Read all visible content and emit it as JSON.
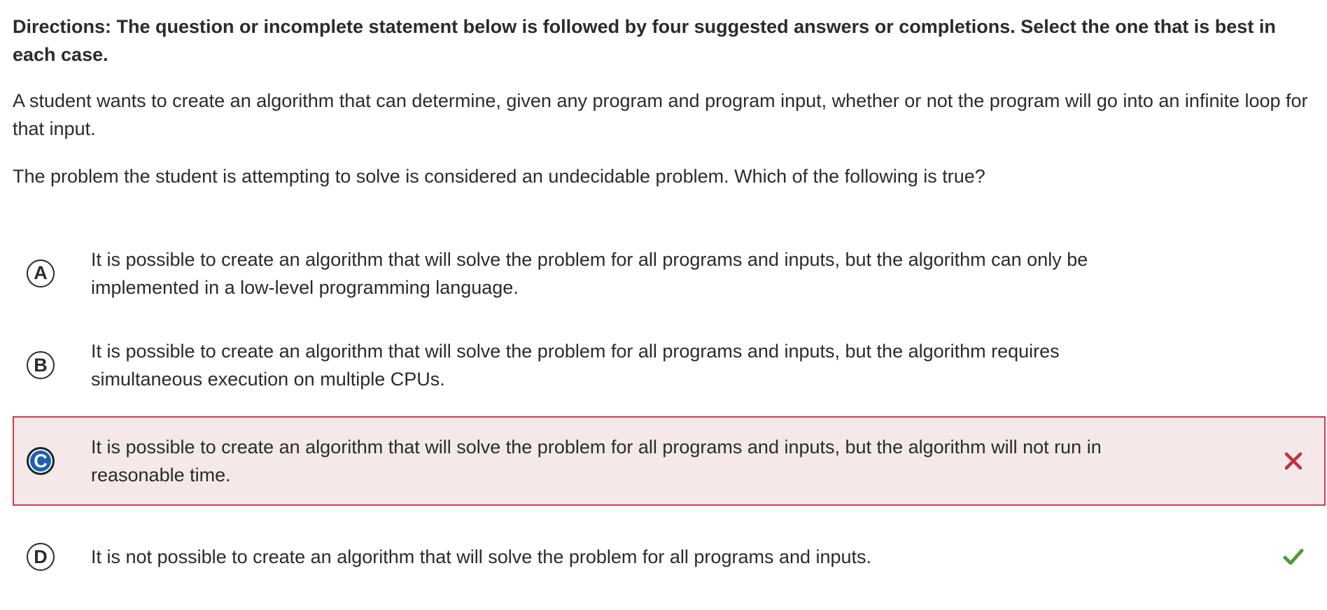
{
  "question": {
    "directions": "Directions: The question or incomplete statement below is followed by four suggested answers or completions. Select the one that is best in each case.",
    "stem_paragraphs": [
      "A student wants to create an algorithm that can determine, given any program and program input, whether or not the program will go into an infinite loop for that input.",
      "The problem the student is attempting to solve is considered an undecidable problem. Which of the following is true?"
    ]
  },
  "choices": [
    {
      "letter": "A",
      "text": "It is possible to create an algorithm that will solve the problem for all programs and inputs, but the algorithm can only be implemented in a low-level programming language.",
      "state": "none"
    },
    {
      "letter": "B",
      "text": "It is possible to create an algorithm that will solve the problem for all programs and inputs, but the algorithm requires simultaneous execution on multiple CPUs.",
      "state": "none"
    },
    {
      "letter": "C",
      "text": "It is possible to create an algorithm that will solve the problem for all programs and inputs, but the algorithm will not run in reasonable time.",
      "state": "selected-incorrect",
      "status_icon": "close-x-icon"
    },
    {
      "letter": "D",
      "text": "It is not possible to create an algorithm that will solve the problem for all programs and inputs.",
      "state": "correct",
      "status_icon": "checkmark-icon"
    }
  ],
  "colors": {
    "selected_fill": "#1f5fb0",
    "incorrect_border": "#d13c4a",
    "incorrect_background": "#f5e8e8",
    "incorrect_icon": "#c0303d",
    "correct_icon": "#4f9a3c",
    "text": "#2b2b2b"
  }
}
